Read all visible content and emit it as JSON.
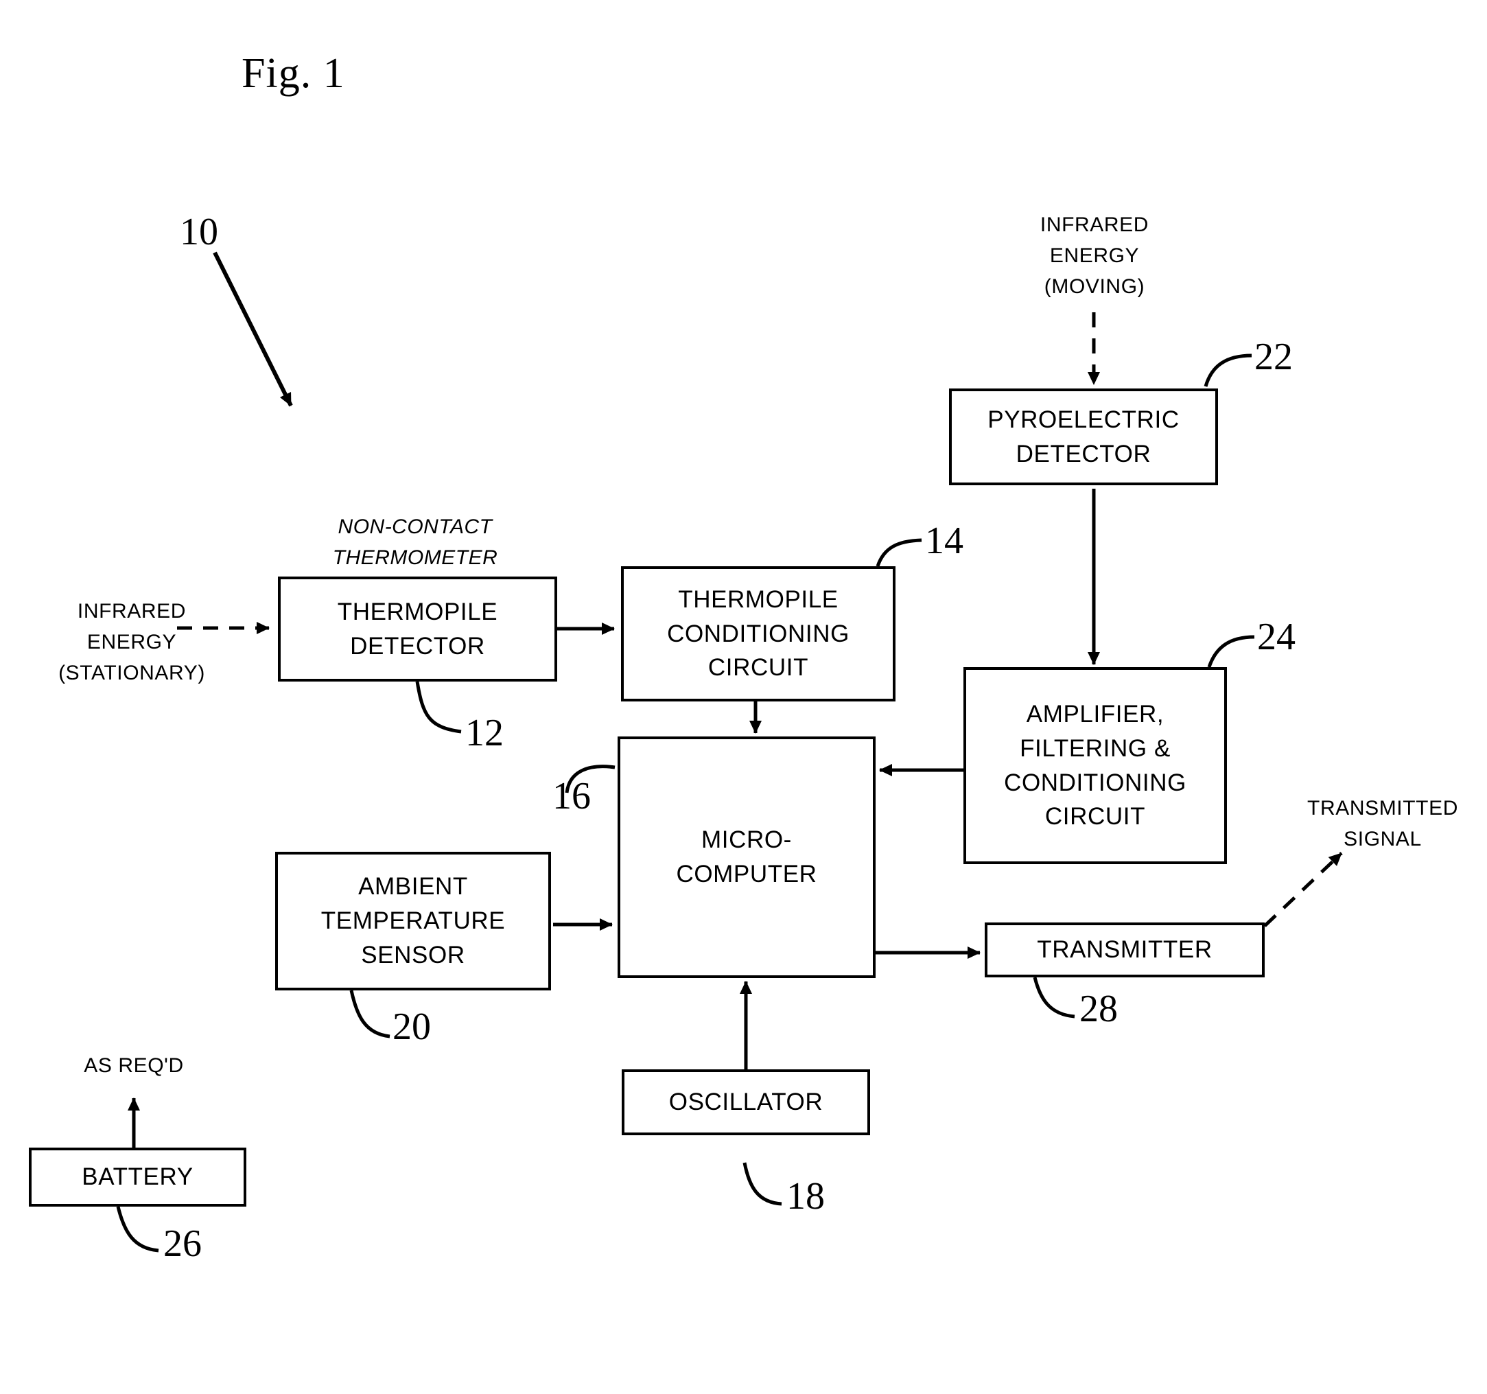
{
  "figure": {
    "title": "Fig. 1",
    "system_ref": "10"
  },
  "blocks": [
    {
      "id": "thermopile-detector",
      "lines": [
        "THERMOPILE",
        "DETECTOR"
      ],
      "ref": "12"
    },
    {
      "id": "thermopile-conditioning-circuit",
      "lines": [
        "THERMOPILE",
        "CONDITIONING",
        "CIRCUIT"
      ],
      "ref": "14"
    },
    {
      "id": "micro-computer",
      "lines": [
        "MICRO-",
        "COMPUTER"
      ],
      "ref": "16"
    },
    {
      "id": "oscillator",
      "lines": [
        "OSCILLATOR"
      ],
      "ref": "18"
    },
    {
      "id": "ambient-temperature-sensor",
      "lines": [
        "AMBIENT",
        "TEMPERATURE",
        "SENSOR"
      ],
      "ref": "20"
    },
    {
      "id": "pyroelectric-detector",
      "lines": [
        "PYROELECTRIC",
        "DETECTOR"
      ],
      "ref": "22"
    },
    {
      "id": "amplifier-filtering-conditioning-circuit",
      "lines": [
        "AMPLIFIER,",
        "FILTERING &",
        "CONDITIONING",
        "CIRCUIT"
      ],
      "ref": "24"
    },
    {
      "id": "battery",
      "lines": [
        "BATTERY"
      ],
      "ref": "26"
    },
    {
      "id": "transmitter",
      "lines": [
        "TRANSMITTER"
      ],
      "ref": "28"
    }
  ],
  "labels": {
    "non_contact_thermometer": [
      "NON-CONTACT",
      "THERMOMETER"
    ],
    "infrared_energy_stationary": [
      "INFRARED",
      "ENERGY",
      "(STATIONARY)"
    ],
    "infrared_energy_moving": [
      "INFRARED",
      "ENERGY",
      "(MOVING)"
    ],
    "transmitted_signal": [
      "TRANSMITTED",
      "SIGNAL"
    ],
    "as_reqd": [
      "AS REQ'D"
    ]
  },
  "style": {
    "ink": "#000000",
    "paper": "#ffffff"
  }
}
